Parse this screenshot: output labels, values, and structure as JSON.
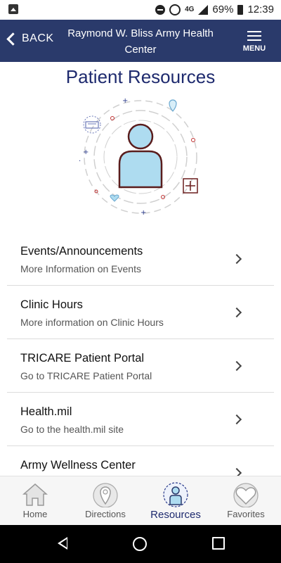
{
  "status_bar": {
    "network": "4G",
    "battery": "69%",
    "time": "12:39"
  },
  "header": {
    "back_label": "BACK",
    "title": "Raymond W. Bliss Army Health Center",
    "menu_label": "MENU"
  },
  "page_title": "Patient Resources",
  "resources": [
    {
      "title": "Events/Announcements",
      "subtitle": "More Information on Events"
    },
    {
      "title": "Clinic Hours",
      "subtitle": "More information on Clinic Hours"
    },
    {
      "title": "TRICARE Patient Portal",
      "subtitle": "Go to TRICARE Patient Portal"
    },
    {
      "title": "Health.mil",
      "subtitle": "Go to the health.mil site"
    },
    {
      "title": "Army Wellness Center",
      "subtitle": ""
    }
  ],
  "bottom_nav": {
    "tabs": [
      {
        "label": "Home",
        "icon": "home-icon",
        "active": false
      },
      {
        "label": "Directions",
        "icon": "map-pin-icon",
        "active": false
      },
      {
        "label": "Resources",
        "icon": "person-icon",
        "active": true
      },
      {
        "label": "Favorites",
        "icon": "heart-icon",
        "active": false
      }
    ]
  },
  "colors": {
    "header_bg": "#2a3a6b",
    "title_text": "#1e2a6e",
    "accent_light_blue": "#aedcf0",
    "outline_dark_red": "#5a1d1d"
  }
}
